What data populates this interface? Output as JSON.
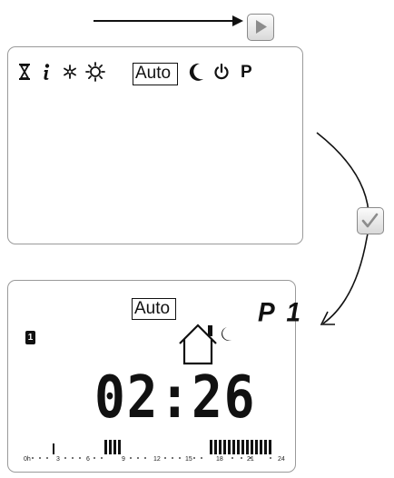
{
  "controls": {
    "next_button_icon": "play-triangle-icon",
    "confirm_button_icon": "checkmark-icon"
  },
  "mode_menu": {
    "icons": [
      "hourglass-icon",
      "info-icon",
      "snowflake-icon",
      "sun-icon",
      "auto-mode",
      "moon-icon",
      "power-icon",
      "program-icon"
    ],
    "auto_label": "Auto",
    "program_label": "P"
  },
  "result_display": {
    "mode_label": "Auto",
    "program": "P 1",
    "zone": "1",
    "time": "02:26",
    "comfort_icon": "house-moon-icon",
    "timeline_labels": [
      "0h",
      "3",
      "6",
      "9",
      "12",
      "15",
      "18",
      "21",
      "24"
    ]
  },
  "colors": {
    "ink": "#111111",
    "border": "#9a9a9a",
    "button_grey": "#8a8a8a"
  }
}
